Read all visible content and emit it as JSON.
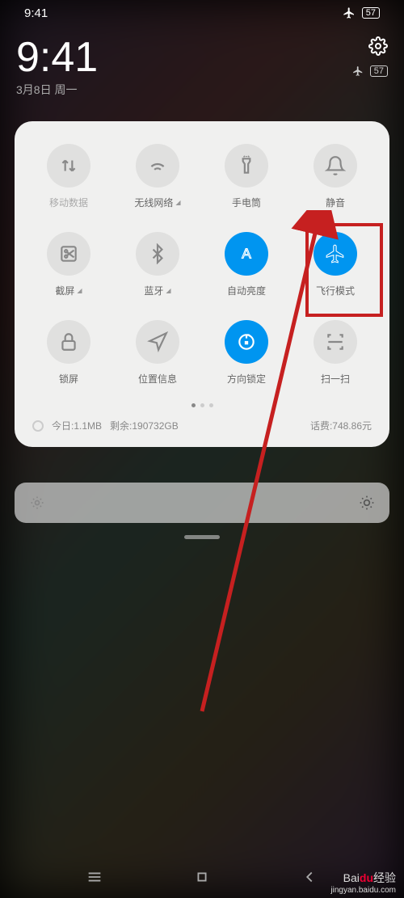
{
  "statusBar": {
    "time": "9:41",
    "battery": "57"
  },
  "header": {
    "time": "9:41",
    "date": "3月8日 周一",
    "battery": "57"
  },
  "tiles": [
    {
      "label": "移动数据",
      "expandable": false
    },
    {
      "label": "无线网络",
      "expandable": true
    },
    {
      "label": "手电筒",
      "expandable": false
    },
    {
      "label": "静音",
      "expandable": false
    },
    {
      "label": "截屏",
      "expandable": true
    },
    {
      "label": "蓝牙",
      "expandable": true
    },
    {
      "label": "自动亮度",
      "expandable": false
    },
    {
      "label": "飞行模式",
      "expandable": false
    },
    {
      "label": "锁屏",
      "expandable": false
    },
    {
      "label": "位置信息",
      "expandable": false
    },
    {
      "label": "方向锁定",
      "expandable": false
    },
    {
      "label": "扫一扫",
      "expandable": false
    }
  ],
  "usage": {
    "today": "今日:1.1MB",
    "remaining": "剩余:190732GB",
    "bill": "话费:748.86元"
  },
  "watermark": {
    "brand_prefix": "Bai",
    "brand_mid": "du",
    "brand_suffix": "经验",
    "url": "jingyan.baidu.com"
  }
}
